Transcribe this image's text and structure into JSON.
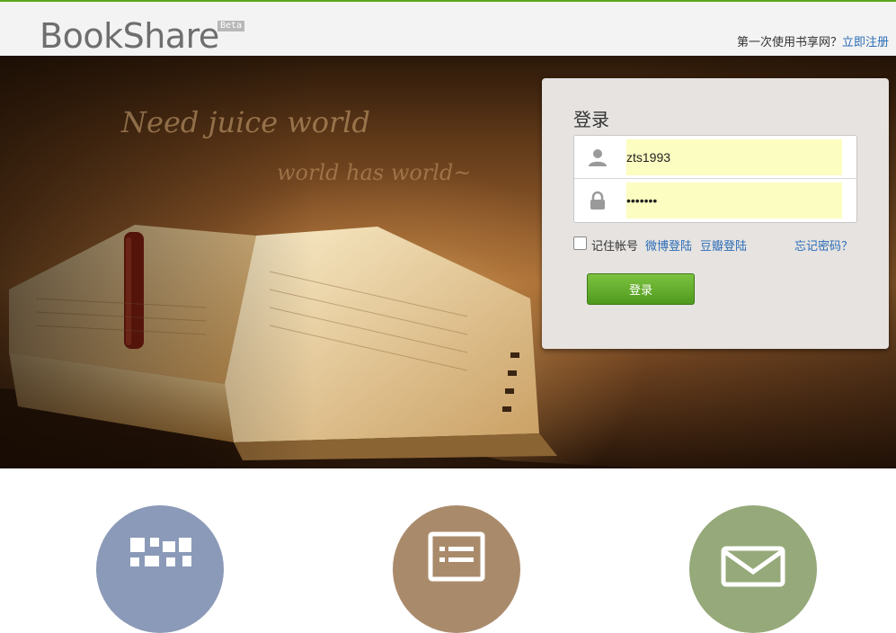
{
  "header": {
    "logo_text": "BookShare",
    "beta_badge": "Beta",
    "prompt_text": "第一次使用书享网？",
    "register_link": "立即注册"
  },
  "hero": {
    "slogan_line1": "Need juice world",
    "slogan_line2": "world has world~"
  },
  "login": {
    "title": "登录",
    "username_value": "zts1993",
    "password_value": "•••••••",
    "remember_label": "记住帐号",
    "weibo_login": "微博登陆",
    "douban_login": "豆瓣登陆",
    "forgot_password": "忘记密码？",
    "submit_label": "登录"
  },
  "features": [
    {
      "icon": "qr-code-icon",
      "color": "#8b9ab8"
    },
    {
      "icon": "list-document-icon",
      "color": "#a98b6c"
    },
    {
      "icon": "mail-icon",
      "color": "#96a97a"
    }
  ],
  "colors": {
    "accent_green": "#5aa81f",
    "link_blue": "#2b6cb7",
    "autofill_yellow": "#fcfdc0"
  }
}
